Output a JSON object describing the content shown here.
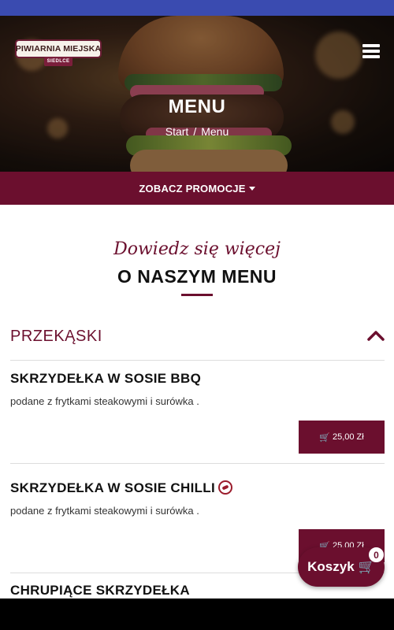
{
  "header": {
    "logo_text": "PIWIARNIA MIEJSKA",
    "logo_subtext": "SIEDLCE",
    "title": "MENU",
    "breadcrumb": {
      "home": "Start",
      "separator": "/",
      "current": "Menu"
    }
  },
  "promo": {
    "label": "ZOBACZ PROMOCJE"
  },
  "intro": {
    "script_text": "Dowiedz się więcej",
    "heading": "O NASZYM MENU"
  },
  "category": {
    "name": "PRZEKĄSKI"
  },
  "items": [
    {
      "title": "SKRZYDEŁKA W SOSIE BBQ",
      "description": "podane z frytkami steakowymi i surówka .",
      "price": "25,00 Zł"
    },
    {
      "title": "SKRZYDEŁKA W SOSIE CHILLI",
      "description": "podane z frytkami steakowymi i surówka .",
      "price": "25,00 Zł"
    },
    {
      "title": "CHRUPIĄCE SKRZYDEŁKA"
    }
  ],
  "cart": {
    "label": "Koszyk",
    "count": "0"
  },
  "colors": {
    "accent": "#6b0f2e",
    "statusbar": "#3a4bb0"
  }
}
